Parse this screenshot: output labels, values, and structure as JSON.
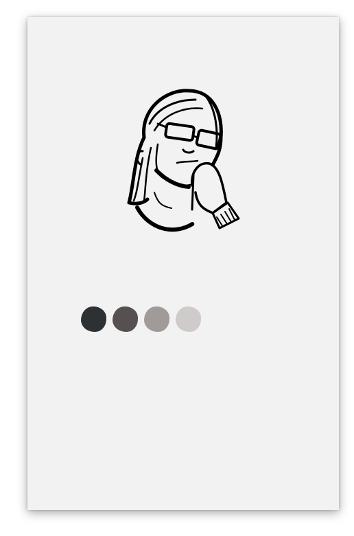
{
  "card": {
    "background": "#f2f2f2"
  },
  "portrait": {
    "icon": "man-thinking-illustration"
  },
  "palette": [
    {
      "color": "#2d3134"
    },
    {
      "color": "#575051"
    },
    {
      "color": "#a09a99"
    },
    {
      "color": "#cfcbcb"
    }
  ]
}
